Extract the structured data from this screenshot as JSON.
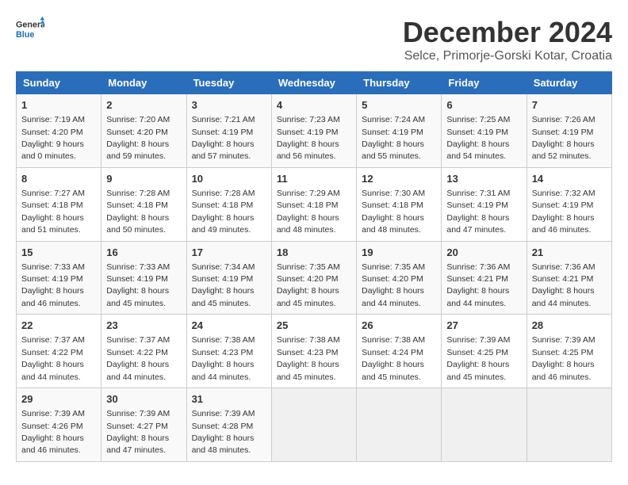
{
  "header": {
    "logo_line1": "General",
    "logo_line2": "Blue",
    "title": "December 2024",
    "subtitle": "Selce, Primorje-Gorski Kotar, Croatia"
  },
  "calendar": {
    "days_of_week": [
      "Sunday",
      "Monday",
      "Tuesday",
      "Wednesday",
      "Thursday",
      "Friday",
      "Saturday"
    ],
    "weeks": [
      [
        {
          "day": "",
          "info": ""
        },
        {
          "day": "2",
          "info": "Sunrise: 7:20 AM\nSunset: 4:20 PM\nDaylight: 8 hours\nand 59 minutes."
        },
        {
          "day": "3",
          "info": "Sunrise: 7:21 AM\nSunset: 4:19 PM\nDaylight: 8 hours\nand 57 minutes."
        },
        {
          "day": "4",
          "info": "Sunrise: 7:23 AM\nSunset: 4:19 PM\nDaylight: 8 hours\nand 56 minutes."
        },
        {
          "day": "5",
          "info": "Sunrise: 7:24 AM\nSunset: 4:19 PM\nDaylight: 8 hours\nand 55 minutes."
        },
        {
          "day": "6",
          "info": "Sunrise: 7:25 AM\nSunset: 4:19 PM\nDaylight: 8 hours\nand 54 minutes."
        },
        {
          "day": "7",
          "info": "Sunrise: 7:26 AM\nSunset: 4:19 PM\nDaylight: 8 hours\nand 52 minutes."
        }
      ],
      [
        {
          "day": "8",
          "info": "Sunrise: 7:27 AM\nSunset: 4:18 PM\nDaylight: 8 hours\nand 51 minutes."
        },
        {
          "day": "9",
          "info": "Sunrise: 7:28 AM\nSunset: 4:18 PM\nDaylight: 8 hours\nand 50 minutes."
        },
        {
          "day": "10",
          "info": "Sunrise: 7:28 AM\nSunset: 4:18 PM\nDaylight: 8 hours\nand 49 minutes."
        },
        {
          "day": "11",
          "info": "Sunrise: 7:29 AM\nSunset: 4:18 PM\nDaylight: 8 hours\nand 48 minutes."
        },
        {
          "day": "12",
          "info": "Sunrise: 7:30 AM\nSunset: 4:18 PM\nDaylight: 8 hours\nand 48 minutes."
        },
        {
          "day": "13",
          "info": "Sunrise: 7:31 AM\nSunset: 4:19 PM\nDaylight: 8 hours\nand 47 minutes."
        },
        {
          "day": "14",
          "info": "Sunrise: 7:32 AM\nSunset: 4:19 PM\nDaylight: 8 hours\nand 46 minutes."
        }
      ],
      [
        {
          "day": "15",
          "info": "Sunrise: 7:33 AM\nSunset: 4:19 PM\nDaylight: 8 hours\nand 46 minutes."
        },
        {
          "day": "16",
          "info": "Sunrise: 7:33 AM\nSunset: 4:19 PM\nDaylight: 8 hours\nand 45 minutes."
        },
        {
          "day": "17",
          "info": "Sunrise: 7:34 AM\nSunset: 4:19 PM\nDaylight: 8 hours\nand 45 minutes."
        },
        {
          "day": "18",
          "info": "Sunrise: 7:35 AM\nSunset: 4:20 PM\nDaylight: 8 hours\nand 45 minutes."
        },
        {
          "day": "19",
          "info": "Sunrise: 7:35 AM\nSunset: 4:20 PM\nDaylight: 8 hours\nand 44 minutes."
        },
        {
          "day": "20",
          "info": "Sunrise: 7:36 AM\nSunset: 4:21 PM\nDaylight: 8 hours\nand 44 minutes."
        },
        {
          "day": "21",
          "info": "Sunrise: 7:36 AM\nSunset: 4:21 PM\nDaylight: 8 hours\nand 44 minutes."
        }
      ],
      [
        {
          "day": "22",
          "info": "Sunrise: 7:37 AM\nSunset: 4:22 PM\nDaylight: 8 hours\nand 44 minutes."
        },
        {
          "day": "23",
          "info": "Sunrise: 7:37 AM\nSunset: 4:22 PM\nDaylight: 8 hours\nand 44 minutes."
        },
        {
          "day": "24",
          "info": "Sunrise: 7:38 AM\nSunset: 4:23 PM\nDaylight: 8 hours\nand 44 minutes."
        },
        {
          "day": "25",
          "info": "Sunrise: 7:38 AM\nSunset: 4:23 PM\nDaylight: 8 hours\nand 45 minutes."
        },
        {
          "day": "26",
          "info": "Sunrise: 7:38 AM\nSunset: 4:24 PM\nDaylight: 8 hours\nand 45 minutes."
        },
        {
          "day": "27",
          "info": "Sunrise: 7:39 AM\nSunset: 4:25 PM\nDaylight: 8 hours\nand 45 minutes."
        },
        {
          "day": "28",
          "info": "Sunrise: 7:39 AM\nSunset: 4:25 PM\nDaylight: 8 hours\nand 46 minutes."
        }
      ],
      [
        {
          "day": "29",
          "info": "Sunrise: 7:39 AM\nSunset: 4:26 PM\nDaylight: 8 hours\nand 46 minutes."
        },
        {
          "day": "30",
          "info": "Sunrise: 7:39 AM\nSunset: 4:27 PM\nDaylight: 8 hours\nand 47 minutes."
        },
        {
          "day": "31",
          "info": "Sunrise: 7:39 AM\nSunset: 4:28 PM\nDaylight: 8 hours\nand 48 minutes."
        },
        {
          "day": "",
          "info": ""
        },
        {
          "day": "",
          "info": ""
        },
        {
          "day": "",
          "info": ""
        },
        {
          "day": "",
          "info": ""
        }
      ]
    ],
    "week0_day1": {
      "day": "1",
      "info": "Sunrise: 7:19 AM\nSunset: 4:20 PM\nDaylight: 9 hours\nand 0 minutes."
    }
  }
}
